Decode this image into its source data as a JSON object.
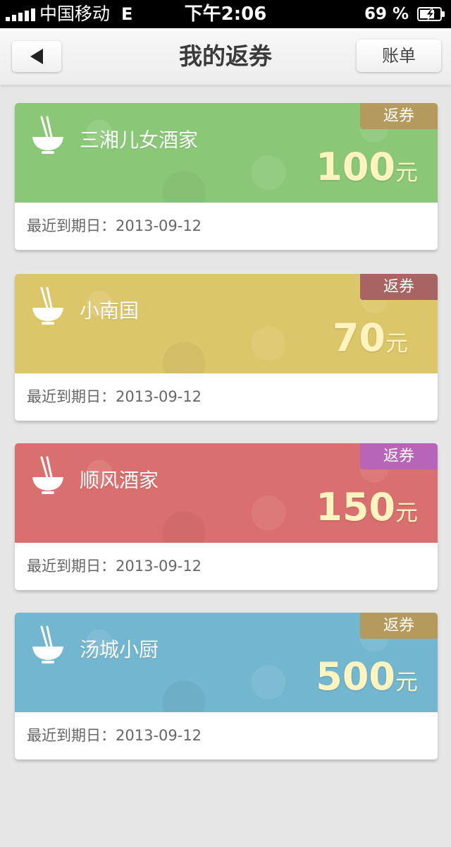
{
  "status_bar": {
    "carrier": "中国移动",
    "network": "E",
    "time": "下午2:06",
    "battery": "69 %"
  },
  "nav": {
    "title": "我的返券",
    "right_button": "账单"
  },
  "coupons": [
    {
      "name": "三湘儿女酒家",
      "tag": "返券",
      "amount": "100",
      "unit": "元",
      "expiry_label": "最近到期日：",
      "expiry_date": "2013-09-12",
      "bg_color": "#8ac878",
      "tag_color": "#b59a5e"
    },
    {
      "name": "小南国",
      "tag": "返券",
      "amount": "70",
      "unit": "元",
      "expiry_label": "最近到期日：",
      "expiry_date": "2013-09-12",
      "bg_color": "#dcc66a",
      "tag_color": "#a86462"
    },
    {
      "name": "顺风酒家",
      "tag": "返券",
      "amount": "150",
      "unit": "元",
      "expiry_label": "最近到期日：",
      "expiry_date": "2013-09-12",
      "bg_color": "#d96f6e",
      "tag_color": "#b665b8"
    },
    {
      "name": "汤城小厨",
      "tag": "返券",
      "amount": "500",
      "unit": "元",
      "expiry_label": "最近到期日：",
      "expiry_date": "2013-09-12",
      "bg_color": "#72b6cf",
      "tag_color": "#b59a5e"
    }
  ],
  "icons": {
    "back": "back-arrow-icon",
    "coupon": "rice-bowl-chopsticks-icon"
  }
}
